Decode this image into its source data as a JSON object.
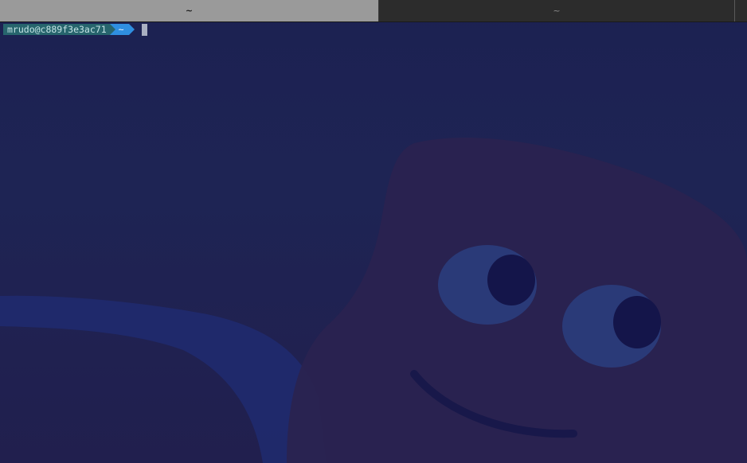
{
  "tabs": [
    {
      "label": "~",
      "active": true
    },
    {
      "label": "~",
      "active": false
    }
  ],
  "prompt": {
    "user_host": "mrudo@c889f3e3ac71",
    "directory": "~"
  },
  "colors": {
    "background": "#1d2250",
    "prompt_user_bg": "#27656d",
    "prompt_dir_bg": "#2f8fe0",
    "cursor": "#a9b0c2"
  }
}
